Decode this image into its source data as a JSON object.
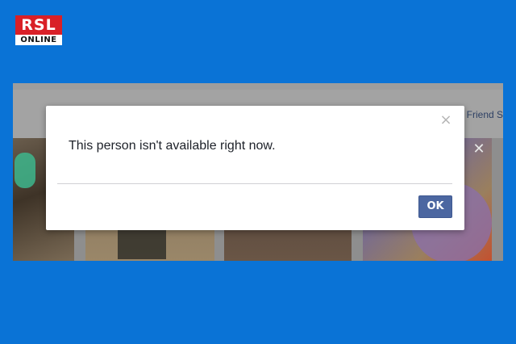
{
  "logo": {
    "top_text": "RSL",
    "bottom_text": "ONLINE"
  },
  "background": {
    "friend_link": "See All Friend S",
    "photo_close_symbol": "✕"
  },
  "dialog": {
    "close_symbol": "×",
    "message": "This person isn't available right now.",
    "ok_label": "OK"
  },
  "colors": {
    "page_background": "#0a73d6",
    "ok_button": "#4c67a1",
    "logo_red": "#d92027"
  }
}
